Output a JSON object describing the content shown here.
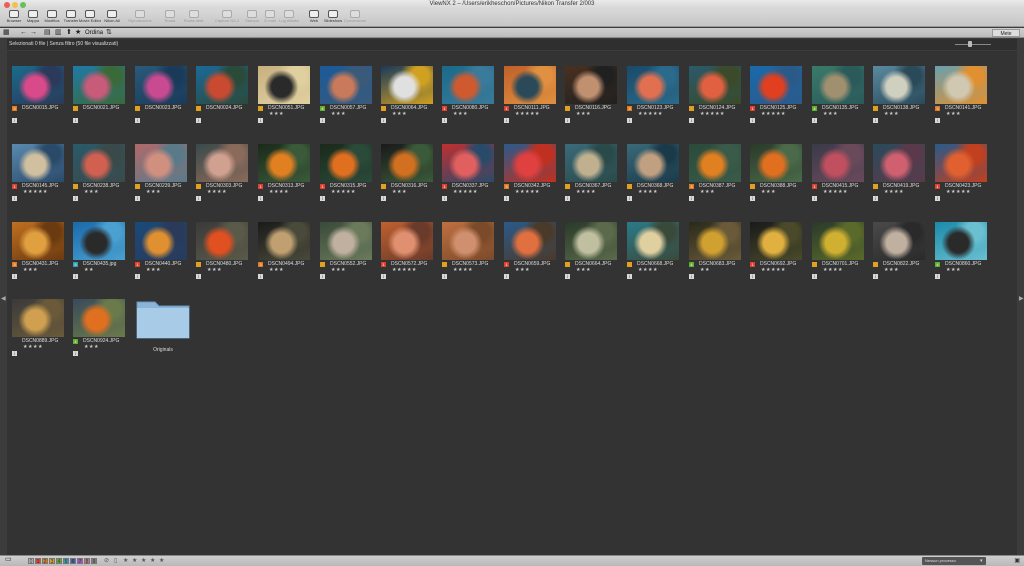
{
  "window": {
    "title": "ViewNX 2 – /Users/erikheschon/Pictures/Nikon Transfer 2/003",
    "traffic_colors": [
      "#ec5f57",
      "#f4bf4f",
      "#60c454"
    ]
  },
  "toolbar": {
    "items": [
      {
        "label": "Browser",
        "enabled": true
      },
      {
        "label": "Mappa",
        "enabled": true
      },
      {
        "label": "Modifica",
        "enabled": true
      },
      {
        "label": "Transfer",
        "enabled": true
      },
      {
        "label": "Movie Editor",
        "enabled": true
      },
      {
        "label": "Nikon All",
        "enabled": true
      },
      {
        "label": "Riproduzione",
        "enabled": false
      },
      {
        "label": "Ruota",
        "enabled": false
      },
      {
        "label": "Ruota dest.",
        "enabled": false
      },
      {
        "label": "Capture NX 2",
        "enabled": false
      },
      {
        "label": "Stampa",
        "enabled": false
      },
      {
        "label": "E-mail",
        "enabled": false
      },
      {
        "label": "Log Attivita",
        "enabled": false
      },
      {
        "label": "Web",
        "enabled": true
      },
      {
        "label": "Slideshow",
        "enabled": true
      },
      {
        "label": "Conversione",
        "enabled": false
      }
    ]
  },
  "secondbar": {
    "grid_icon": "grid-icon",
    "back_icon": "←",
    "forward_icon": "→",
    "order_label": "Ordina",
    "right_panel": "Mete"
  },
  "infobar": {
    "status": "Selezionati 0 file | Senza filtro (50 file visualizzati)"
  },
  "files": [
    {
      "name": "DSCN0015.JPG",
      "stars": "",
      "label_color": "#e07a20",
      "label_num": "3",
      "colors": [
        "#1a6b8c",
        "#d94a8a",
        "#2a3a5a"
      ]
    },
    {
      "name": "DSCN0021.JPG",
      "stars": "",
      "label_color": "#e0a020",
      "label_num": "",
      "colors": [
        "#1f7aa8",
        "#c85a7a",
        "#3a6a3a"
      ]
    },
    {
      "name": "DSCN0023.JPG",
      "stars": "",
      "label_color": "#e0a020",
      "label_num": "",
      "colors": [
        "#2a5a7a",
        "#c84a90",
        "#1a3a5a"
      ]
    },
    {
      "name": "DSCN0024.JPG",
      "stars": "",
      "label_color": "#e0a020",
      "label_num": "",
      "colors": [
        "#1a6a9a",
        "#c84a30",
        "#2a4a3a"
      ]
    },
    {
      "name": "DSCN0051.JPG",
      "stars": "★★★",
      "label_color": "#e0a020",
      "label_num": "",
      "colors": [
        "#c8b080",
        "#2a2a2a",
        "#e0d0a0"
      ]
    },
    {
      "name": "DSCN0057.JPG",
      "stars": "★★★",
      "label_color": "#60b030",
      "label_num": "4",
      "colors": [
        "#1a5a9a",
        "#c87a5a",
        "#3a5a7a"
      ]
    },
    {
      "name": "DSCN0064.JPG",
      "stars": "★★★",
      "label_color": "#e0a020",
      "label_num": "",
      "colors": [
        "#1a3a5a",
        "#e0e0e0",
        "#d0a020"
      ]
    },
    {
      "name": "DSCN0080.JPG",
      "stars": "★★★",
      "label_color": "#e04030",
      "label_num": "1",
      "colors": [
        "#1a6a8a",
        "#d05a30",
        "#3a7a9a"
      ]
    },
    {
      "name": "DSCN0111.JPG",
      "stars": "★★★★★",
      "label_color": "#e04030",
      "label_num": "1",
      "colors": [
        "#c0602a",
        "#2a4a5a",
        "#e09040"
      ]
    },
    {
      "name": "DSCN0116.JPG",
      "stars": "★★★",
      "label_color": "#e0a020",
      "label_num": "",
      "colors": [
        "#4a3020",
        "#c09070",
        "#202020"
      ]
    },
    {
      "name": "DSCN0123.JPG",
      "stars": "★★★★★",
      "label_color": "#e07a20",
      "label_num": "3",
      "colors": [
        "#1a4a6a",
        "#e07050",
        "#2a6a8a"
      ]
    },
    {
      "name": "DSCN0124.JPG",
      "stars": "★★★★★",
      "label_color": "#e0a020",
      "label_num": "",
      "colors": [
        "#2a5a6a",
        "#e06040",
        "#3a4a2a"
      ]
    },
    {
      "name": "DSCN0125.JPG",
      "stars": "★★★★★",
      "label_color": "#e04030",
      "label_num": "1",
      "colors": [
        "#1a6aaa",
        "#e04020",
        "#2a5a8a"
      ]
    },
    {
      "name": "DSCN0135.JPG",
      "stars": "★★★",
      "label_color": "#60b030",
      "label_num": "4",
      "colors": [
        "#3a7a6a",
        "#a09070",
        "#2a5a5a"
      ]
    },
    {
      "name": "DSCN0138.JPG",
      "stars": "★★★",
      "label_color": "#e0a020",
      "label_num": "",
      "colors": [
        "#5a8aa0",
        "#d0d0c0",
        "#2a4a5a"
      ]
    },
    {
      "name": "DSCN0141.JPG",
      "stars": "★★★",
      "label_color": "#e07a20",
      "label_num": "3",
      "colors": [
        "#6aa0b0",
        "#d0c8b0",
        "#e09030"
      ]
    },
    {
      "name": "DSCN0145.JPG",
      "stars": "★★★★★",
      "label_color": "#e04030",
      "label_num": "1",
      "colors": [
        "#5a8ab0",
        "#d0c0a0",
        "#2a4a6a"
      ]
    },
    {
      "name": "DSCN0238.JPG",
      "stars": "★★★",
      "label_color": "#e0a020",
      "label_num": "",
      "colors": [
        "#2a5a6a",
        "#d06050",
        "#3a4a4a"
      ]
    },
    {
      "name": "DSCN0239.JPG",
      "stars": "★★★",
      "label_color": "#e0a020",
      "label_num": "",
      "colors": [
        "#b06a6a",
        "#d09080",
        "#5a7a8a"
      ]
    },
    {
      "name": "DSCN0303.JPG",
      "stars": "★★★★",
      "label_color": "#e0a020",
      "label_num": "",
      "colors": [
        "#3a4a4a",
        "#d0a090",
        "#8a6a5a"
      ]
    },
    {
      "name": "DSCN0313.JPG",
      "stars": "★★★★",
      "label_color": "#e04030",
      "label_num": "1",
      "colors": [
        "#1a2a1a",
        "#e08020",
        "#3a5a3a"
      ]
    },
    {
      "name": "DSCN0315.JPG",
      "stars": "★★★★★",
      "label_color": "#e04030",
      "label_num": "1",
      "colors": [
        "#1a2a1a",
        "#e07020",
        "#2a4a3a"
      ]
    },
    {
      "name": "DSCN0316.JPG",
      "stars": "★★★",
      "label_color": "#e0a020",
      "label_num": "",
      "colors": [
        "#1a1a1a",
        "#d07020",
        "#3a5a3a"
      ]
    },
    {
      "name": "DSCN0337.JPG",
      "stars": "★★★★★",
      "label_color": "#e04030",
      "label_num": "1",
      "colors": [
        "#c03030",
        "#e06060",
        "#2a4a6a"
      ]
    },
    {
      "name": "DSCN0342.JPG",
      "stars": "★★★★★",
      "label_color": "#e07a20",
      "label_num": "3",
      "colors": [
        "#2a5a8a",
        "#e04040",
        "#c03020"
      ]
    },
    {
      "name": "DSCN0367.JPG",
      "stars": "★★★★",
      "label_color": "#e0a020",
      "label_num": "",
      "colors": [
        "#3a6a7a",
        "#c0b090",
        "#2a4a4a"
      ]
    },
    {
      "name": "DSCN0368.JPG",
      "stars": "★★★★",
      "label_color": "#e0a020",
      "label_num": "",
      "colors": [
        "#3a6a7a",
        "#c0a080",
        "#1a3a4a"
      ]
    },
    {
      "name": "DSCN0387.JPG",
      "stars": "★★★",
      "label_color": "#e07a20",
      "label_num": "3",
      "colors": [
        "#2a4a3a",
        "#e08020",
        "#3a5a4a"
      ]
    },
    {
      "name": "DSCN0388.JPG",
      "stars": "★★★",
      "label_color": "#e0a020",
      "label_num": "",
      "colors": [
        "#2a3a2a",
        "#e07020",
        "#4a6a4a"
      ]
    },
    {
      "name": "DSCN0415.JPG",
      "stars": "★★★★★",
      "label_color": "#e04030",
      "label_num": "1",
      "colors": [
        "#3a3a4a",
        "#c05060",
        "#6a4a5a"
      ]
    },
    {
      "name": "DSCN0419.JPG",
      "stars": "★★★★",
      "label_color": "#e0a020",
      "label_num": "",
      "colors": [
        "#2a4a5a",
        "#d06070",
        "#5a3a4a"
      ]
    },
    {
      "name": "DSCN0423.JPG",
      "stars": "★★★★★",
      "label_color": "#e04030",
      "label_num": "1",
      "colors": [
        "#2a5a8a",
        "#e06030",
        "#c04020"
      ]
    },
    {
      "name": "DSCN0431.JPG",
      "stars": "★★★",
      "label_color": "#e07a20",
      "label_num": "3",
      "colors": [
        "#c07020",
        "#e0a040",
        "#6a3a10"
      ]
    },
    {
      "name": "DSCN0435.jpg",
      "stars": "★★",
      "label_color": "#30a0b0",
      "label_num": "5",
      "colors": [
        "#1a6aaa",
        "#2a2a2a",
        "#4aa0d0"
      ]
    },
    {
      "name": "DSCN0440.JPG",
      "stars": "★★★",
      "label_color": "#e04030",
      "label_num": "1",
      "colors": [
        "#1a4a7a",
        "#e09030",
        "#2a3a5a"
      ]
    },
    {
      "name": "DSCN0480.JPG",
      "stars": "★★★",
      "label_color": "#e0a020",
      "label_num": "",
      "colors": [
        "#3a3a3a",
        "#e05020",
        "#5a5a4a"
      ]
    },
    {
      "name": "DSCN0494.JPG",
      "stars": "★★★",
      "label_color": "#e07a20",
      "label_num": "3",
      "colors": [
        "#1a1a1a",
        "#c0a070",
        "#4a4a3a"
      ]
    },
    {
      "name": "DSCN0552.JPG",
      "stars": "★★★",
      "label_color": "#e0a020",
      "label_num": "",
      "colors": [
        "#3a4a3a",
        "#c0b0a0",
        "#6a7a5a"
      ]
    },
    {
      "name": "DSCN0572.JPG",
      "stars": "★★★★★",
      "label_color": "#e04030",
      "label_num": "1",
      "colors": [
        "#c06030",
        "#e09070",
        "#6a3a2a"
      ]
    },
    {
      "name": "DSCN0573.JPG",
      "stars": "★★★★",
      "label_color": "#e0a020",
      "label_num": "",
      "colors": [
        "#c07040",
        "#d09070",
        "#7a4a2a"
      ]
    },
    {
      "name": "DSCN0659.JPG",
      "stars": "★★★",
      "label_color": "#e04030",
      "label_num": "1",
      "colors": [
        "#2a5a8a",
        "#e07040",
        "#4a3a2a"
      ]
    },
    {
      "name": "DSCN0664.JPG",
      "stars": "★★★",
      "label_color": "#e0a020",
      "label_num": "",
      "colors": [
        "#2a3a2a",
        "#c0c0a0",
        "#5a6a4a"
      ]
    },
    {
      "name": "DSCN0668.JPG",
      "stars": "★★★★",
      "label_color": "#e0a020",
      "label_num": "",
      "colors": [
        "#2a7a8a",
        "#e0d0a0",
        "#3a4a3a"
      ]
    },
    {
      "name": "DSCN0683.JPG",
      "stars": "★★",
      "label_color": "#60b030",
      "label_num": "4",
      "colors": [
        "#2a2a1a",
        "#d0a030",
        "#6a5a3a"
      ]
    },
    {
      "name": "DSCN0692.JPG",
      "stars": "★★★★★",
      "label_color": "#e04030",
      "label_num": "1",
      "colors": [
        "#1a1a1a",
        "#e0b040",
        "#4a4a2a"
      ]
    },
    {
      "name": "DSCN0701.JPG",
      "stars": "★★★★",
      "label_color": "#e0a020",
      "label_num": "",
      "colors": [
        "#2a3a2a",
        "#d0b030",
        "#5a6a2a"
      ]
    },
    {
      "name": "DSCN0822.JPG",
      "stars": "★★★",
      "label_color": "#e0a020",
      "label_num": "",
      "colors": [
        "#4a4a4a",
        "#c0b0a0",
        "#2a2a2a"
      ]
    },
    {
      "name": "DSCN0860.JPG",
      "stars": "★★★",
      "label_color": "#60b030",
      "label_num": "4",
      "colors": [
        "#1a8aaa",
        "#2a2a2a",
        "#6ac0d0"
      ]
    },
    {
      "name": "DSCN0889.JPG",
      "stars": "★★★★",
      "label_color": "",
      "label_num": "",
      "colors": [
        "#3a3a3a",
        "#d0a050",
        "#6a5a3a"
      ]
    },
    {
      "name": "DSCN0924.JPG",
      "stars": "★★★",
      "label_color": "#60b030",
      "label_num": "4",
      "colors": [
        "#3a4a5a",
        "#e07020",
        "#6a7a4a"
      ]
    }
  ],
  "folder": {
    "label": "Originals",
    "icon": "folder-icon",
    "color": "#8ab4d8"
  },
  "bottombar": {
    "label_filters": [
      {
        "num": "0",
        "color": "#bbbbbb"
      },
      {
        "num": "1",
        "color": "#e04030"
      },
      {
        "num": "2",
        "color": "#e07a20"
      },
      {
        "num": "3",
        "color": "#e0a020"
      },
      {
        "num": "4",
        "color": "#60b030"
      },
      {
        "num": "5",
        "color": "#30a0b0"
      },
      {
        "num": "6",
        "color": "#4060c0"
      },
      {
        "num": "7",
        "color": "#a050c0"
      },
      {
        "num": "8",
        "color": "#d07090"
      },
      {
        "num": "9",
        "color": "#808080"
      }
    ],
    "stars_filter": "★★★★★",
    "sort_value": "Nessun processo"
  }
}
